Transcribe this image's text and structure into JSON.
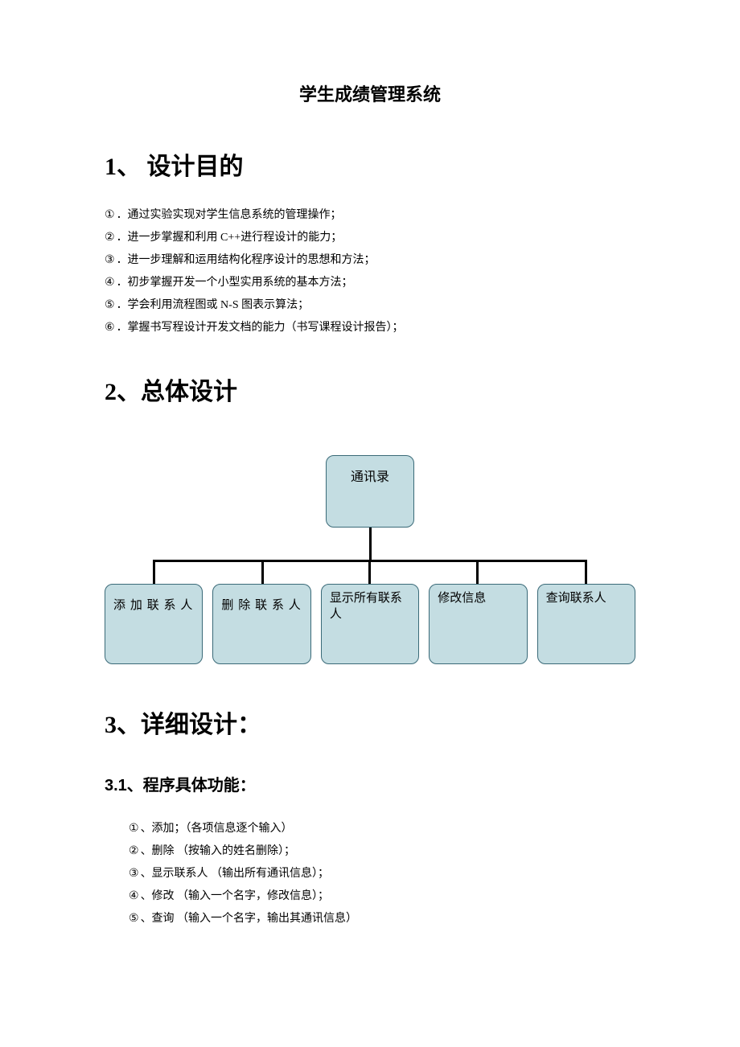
{
  "title": "学生成绩管理系统",
  "sections": {
    "s1": {
      "heading": "1、 设计目的",
      "items": [
        {
          "num": "①",
          "text": "．通过实验实现对学生信息系统的管理操作；"
        },
        {
          "num": "②",
          "text": "．进一步掌握和利用 C++进行程设计的能力；"
        },
        {
          "num": "③",
          "text": "．进一步理解和运用结构化程序设计的思想和方法；"
        },
        {
          "num": "④",
          "text": "．初步掌握开发一个小型实用系统的基本方法；"
        },
        {
          "num": "⑤",
          "text": "．学会利用流程图或 N-S 图表示算法；"
        },
        {
          "num": "⑥",
          "text": "．掌握书写程设计开发文档的能力（书写课程设计报告）；"
        }
      ]
    },
    "s2": {
      "heading": "2、总体设计",
      "diagram": {
        "root": "通讯录",
        "children": [
          "添加联系人",
          "删除联系人",
          "显示所有联系人",
          "修改信息",
          "查询联系人"
        ]
      }
    },
    "s3": {
      "heading": "3、详细设计：",
      "sub": {
        "heading": "3.1、程序具体功能：",
        "items": [
          {
            "num": "①",
            "text": "、添加；（各项信息逐个输入）"
          },
          {
            "num": "②",
            "text": "、删除  （按输入的姓名删除）；"
          },
          {
            "num": "③",
            "text": "、显示联系人  （输出所有通讯信息）；"
          },
          {
            "num": "④",
            "text": "、修改  （输入一个名字，修改信息）；"
          },
          {
            "num": "⑤",
            "text": "、查询  （输入一个名字，输出其通讯信息）"
          }
        ]
      }
    }
  }
}
